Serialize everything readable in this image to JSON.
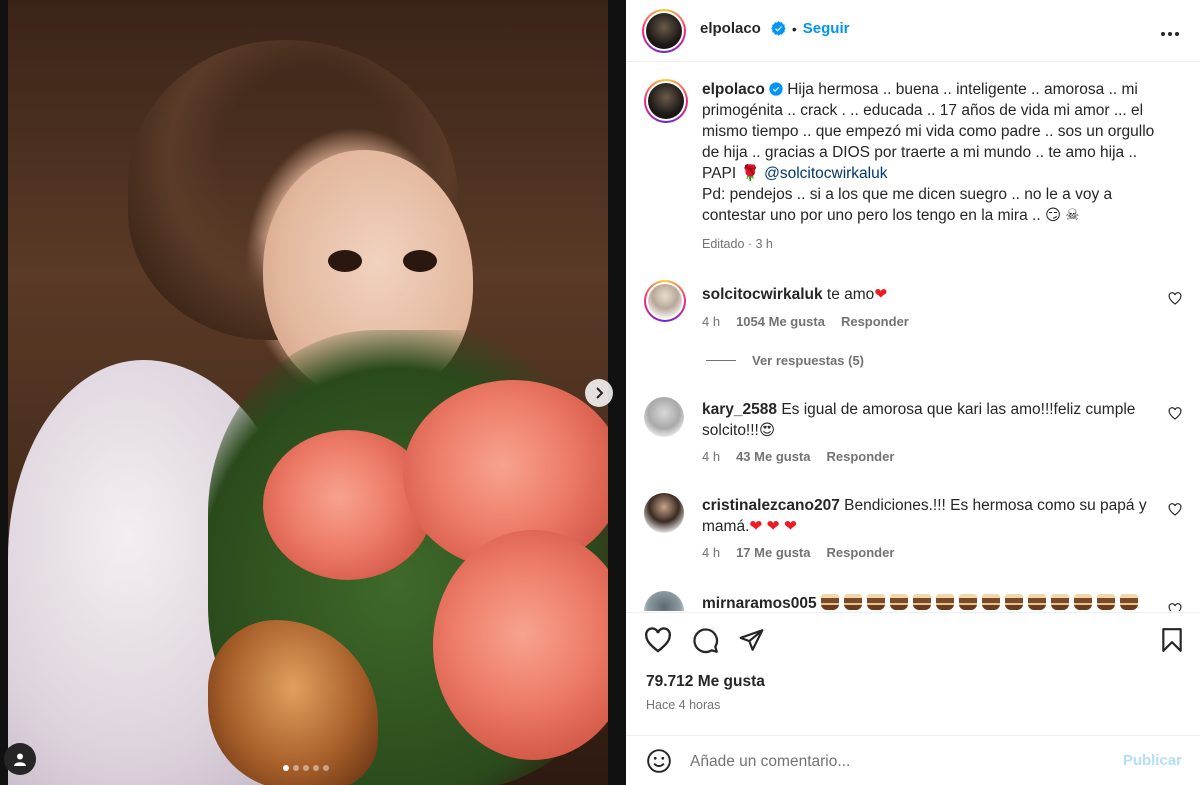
{
  "post": {
    "username": "elpolaco",
    "follow_label": "Seguir",
    "separator": "•",
    "more_label": "•••"
  },
  "caption": {
    "username": "elpolaco",
    "text_main": "Hija hermosa .. buena .. inteligente .. amorosa .. mi primogénita .. crack . .. educada .. 17 años de vida mi amor ... el mismo tiempo .. que empezó mi vida como padre .. sos un orgullo de hija .. gracias a DIOS por traerte a mi mundo .. te amo hija .. PAPI 🌹 ",
    "mention": "@solcitocwirkaluk",
    "text_pd": "Pd: pendejos .. si a los que me dicen suegro .. no le a voy a contestar uno por uno pero los tengo en la mira .. 😏 ☠",
    "meta": "Editado · 3 h"
  },
  "comments": [
    {
      "username": "solcitocwirkaluk",
      "text": "te amo",
      "emoji": "❤",
      "time": "4 h",
      "likes": "1054 Me gusta",
      "reply": "Responder"
    },
    {
      "username": "kary_2588",
      "text": "Es igual de amorosa que kari las amo!!!feliz cumple solcito!!!😍",
      "time": "4 h",
      "likes": "43 Me gusta",
      "reply": "Responder"
    },
    {
      "username": "cristinalezcano207",
      "text": "Bendiciones.!!! Es hermosa como su papá y mamá.",
      "emoji": "❤ ❤ ❤",
      "time": "4 h",
      "likes": "17 Me gusta",
      "reply": "Responder"
    },
    {
      "username": "mirnaramos005",
      "cake_count": 14
    }
  ],
  "view_replies": "Ver respuestas (5)",
  "likes_count": "79.712 Me gusta",
  "posted_time": "Hace 4 horas",
  "comment_placeholder": "Añade un comentario...",
  "publish_label": "Publicar",
  "carousel": {
    "total": 5,
    "active": 1
  },
  "colors": {
    "accent": "#0095f6",
    "text": "#262626",
    "muted": "#737373",
    "heart": "#ed1c24"
  }
}
